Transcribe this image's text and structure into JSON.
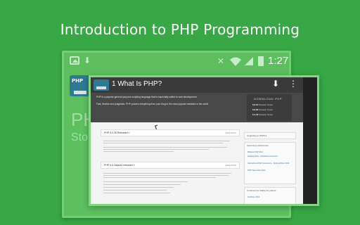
{
  "headline": "Introduction to PHP Programming",
  "back_screen": {
    "status_time": "1:27",
    "partial_word_1": "PH",
    "partial_word_2": "Stor"
  },
  "app": {
    "title": "1 What Is PHP?",
    "download_icon": "download-icon",
    "menu_icon": "overflow-menu-icon"
  },
  "web": {
    "hero_line_1": "PHP is a popular general-purpose scripting language that is especially suited to web development.",
    "hero_line_2": "Fast, flexible and pragmatic, PHP powers everything from your blog to the most popular websites in the world.",
    "download_title": "DOWNLOAD PHP",
    "versions": [
      {
        "num": "5.6.10",
        "label": "Release Notes"
      },
      {
        "num": "5.6.26",
        "label": "Release Notes"
      },
      {
        "num": "5.4.42",
        "label": "Release Notes"
      }
    ],
    "news": [
      {
        "title": "PHP 5.4.26 Released »",
        "date": "2014-03-07"
      },
      {
        "title": "PHP 5.6.0alpha3 released »",
        "date": "2014-03-06"
      }
    ],
    "side_boxes": [
      {
        "title": "Upgrading to PHP5.4",
        "items": []
      },
      {
        "title": "Upcoming conferences",
        "items": [
          "Midwest PHP 2014",
          "php[tek] 2014 - Schedule Announced",
          "International PHP Conference - Spring Edition 2014",
          "PHP Cape Town 2014"
        ]
      },
      {
        "title": "Conferences Calling for papers",
        "items": [
          "ZendCon 2014"
        ]
      }
    ]
  }
}
